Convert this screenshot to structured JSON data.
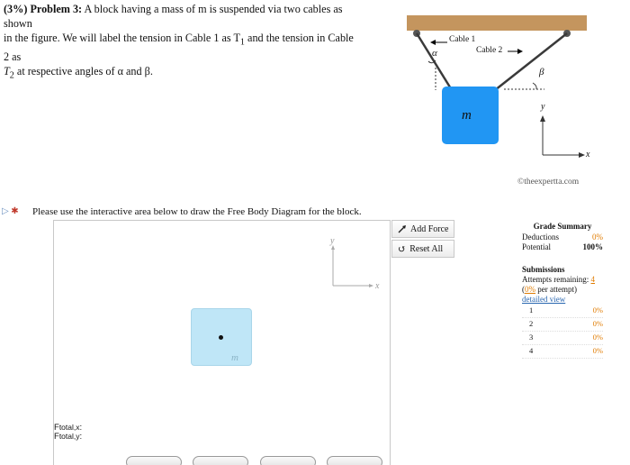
{
  "problem": {
    "weight": "(3%)",
    "label": "Problem 3:",
    "line1": "A block having a mass of m is suspended via two cables as shown",
    "line2": "in the figure. We will label the tension in Cable 1 as T",
    "t1_sub": "1",
    "line2b": " and the tension in Cable 2 as",
    "t2": "T",
    "t2_sub": "2",
    "line3": " at respective angles of α and β."
  },
  "figure": {
    "cable1": "Cable 1",
    "cable2": "Cable 2",
    "alpha": "α",
    "beta": "β",
    "mass": "m",
    "y": "y",
    "x": "x",
    "credit": "©theexpertta.com",
    "colors": {
      "ceiling": "#c4955e",
      "block": "#2196f3",
      "cable": "#3a3a3a"
    }
  },
  "fbd": {
    "icons": "▷ ✱",
    "prompt": "Please use the interactive area below to draw the Free Body Diagram for the block.",
    "axis_y": "y",
    "axis_x": "x",
    "block_label": "m",
    "ftotal_x_label": "total,x",
    "ftotal_y_label": "total,y",
    "f": "F",
    "colon": ":"
  },
  "tools": {
    "add_force": "Add Force",
    "reset_all": "Reset All"
  },
  "grade": {
    "title": "Grade Summary",
    "deductions_label": "Deductions",
    "deductions_value": "0%",
    "potential_label": "Potential",
    "potential_value": "100%",
    "submissions_title": "Submissions",
    "attempts_label": "Attempts remaining:",
    "attempts_value": "4",
    "per_attempt_pct": "0%",
    "per_attempt_text": " per attempt)",
    "detailed": "detailed view",
    "attempts": [
      {
        "n": "1",
        "v": "0%"
      },
      {
        "n": "2",
        "v": "0%"
      },
      {
        "n": "3",
        "v": "0%"
      },
      {
        "n": "4",
        "v": "0%"
      }
    ]
  }
}
